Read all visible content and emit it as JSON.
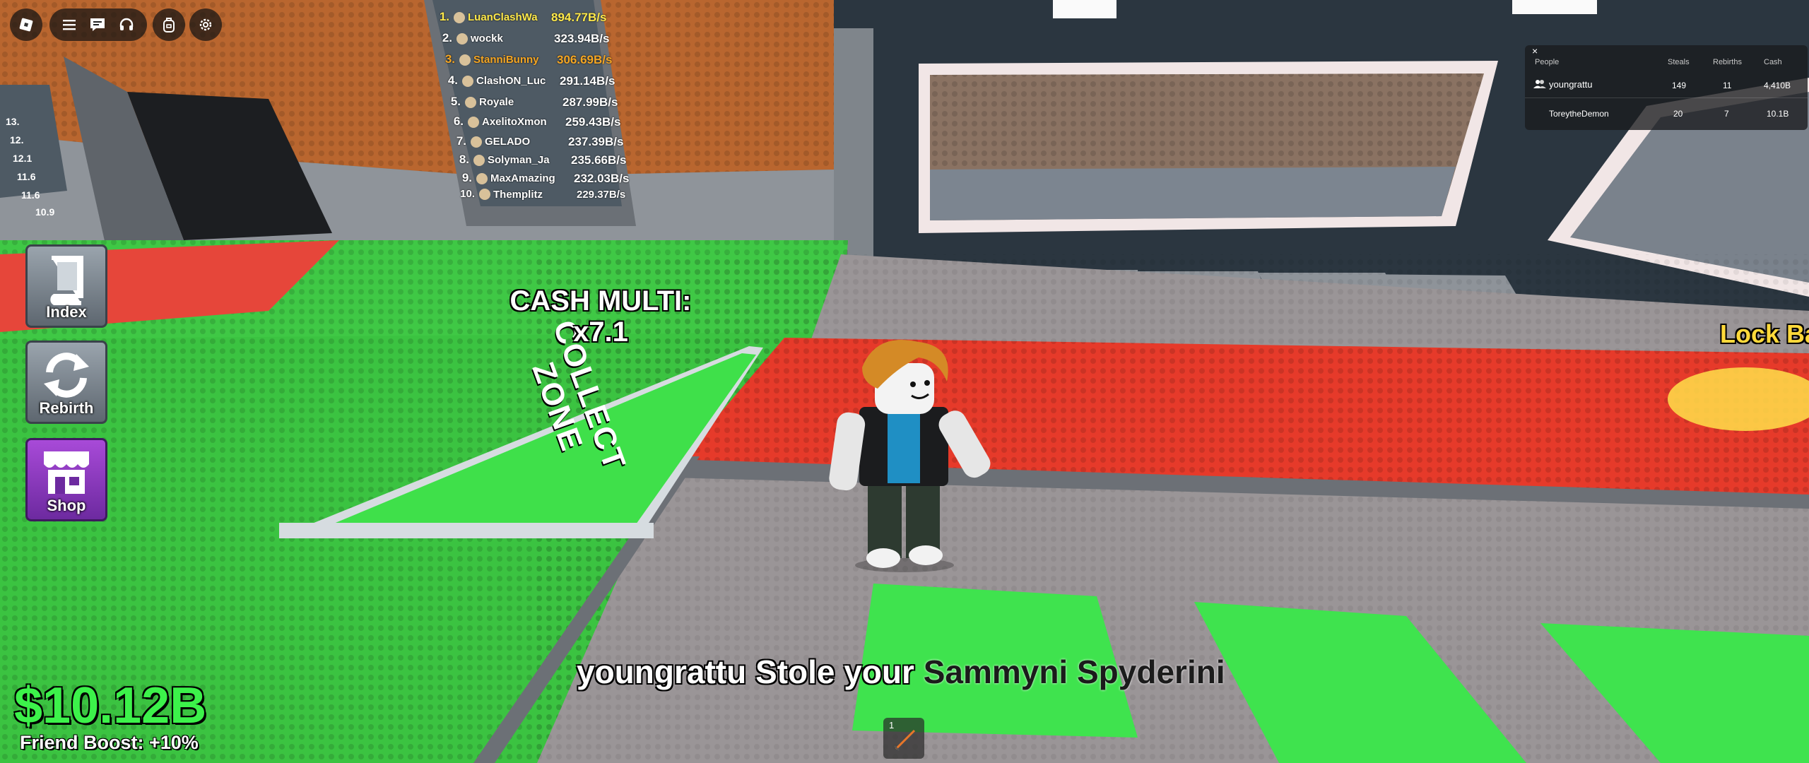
{
  "top_left": {
    "buttons": [
      {
        "icon": "roblox-logo-icon"
      },
      {
        "icon": "menu-icon"
      },
      {
        "icon": "chat-icon"
      },
      {
        "icon": "headset-icon"
      },
      {
        "icon": "backpack-icon"
      },
      {
        "icon": "settings-gear-icon"
      }
    ]
  },
  "side_menu": {
    "index_label": "Index",
    "rebirth_label": "Rebirth",
    "shop_label": "Shop"
  },
  "leaderboard": {
    "entries": [
      {
        "rank": "1.",
        "name": "LuanClashWa",
        "value": "894.77B/s",
        "color": "#ffe94a"
      },
      {
        "rank": "2.",
        "name": "wockk",
        "value": "323.94B/s",
        "color": "#ffffff"
      },
      {
        "rank": "3.",
        "name": "StanniBunny",
        "value": "306.69B/s",
        "color": "#f5a623"
      },
      {
        "rank": "4.",
        "name": "ClashON_Luc",
        "value": "291.14B/s",
        "color": "#ffffff"
      },
      {
        "rank": "5.",
        "name": "Royale",
        "value": "287.99B/s",
        "color": "#ffffff"
      },
      {
        "rank": "6.",
        "name": "AxelitoXmon",
        "value": "259.43B/s",
        "color": "#ffffff"
      },
      {
        "rank": "7.",
        "name": "GELADO",
        "value": "237.39B/s",
        "color": "#ffffff"
      },
      {
        "rank": "8.",
        "name": "Solyman_Ja",
        "value": "235.66B/s",
        "color": "#ffffff"
      },
      {
        "rank": "9.",
        "name": "MaxAmazing",
        "value": "232.03B/s",
        "color": "#ffffff"
      },
      {
        "rank": "10.",
        "name": "Themplitz",
        "value": "229.37B/s",
        "color": "#ffffff"
      }
    ],
    "left_board_values": [
      "13.",
      "12.",
      "12.1",
      "11.6",
      "11.6",
      "10.9"
    ]
  },
  "player_list": {
    "close_glyph": "×",
    "headers": {
      "people": "People",
      "steals": "Steals",
      "rebirths": "Rebirths",
      "cash": "Cash"
    },
    "rows": [
      {
        "name": "youngrattu",
        "steals": "149",
        "rebirths": "11",
        "cash": "4,410B"
      },
      {
        "name": "ToreytheDemon",
        "steals": "20",
        "rebirths": "7",
        "cash": "10.1B"
      }
    ]
  },
  "world": {
    "cash_multi_line1": "CASH MULTI:",
    "cash_multi_line2": "x7.1",
    "collect_word": "COLLECT",
    "zone_word": "ZONE",
    "lock_base_text": "Lock Ba"
  },
  "hud": {
    "money": "$10.12B",
    "friend_boost": "Friend Boost: +10%"
  },
  "notification": {
    "who_text": "youngrattu Stole your",
    "item_text": "Sammyni Spyderini"
  },
  "hotbar": {
    "slot1_number": "1",
    "slot1_icon": "sword-icon"
  },
  "colors": {
    "grass": "#38c43f",
    "red_carpet": "#e63a2a",
    "money_green": "#3cf24a",
    "lock_yellow": "#ffd93a"
  }
}
